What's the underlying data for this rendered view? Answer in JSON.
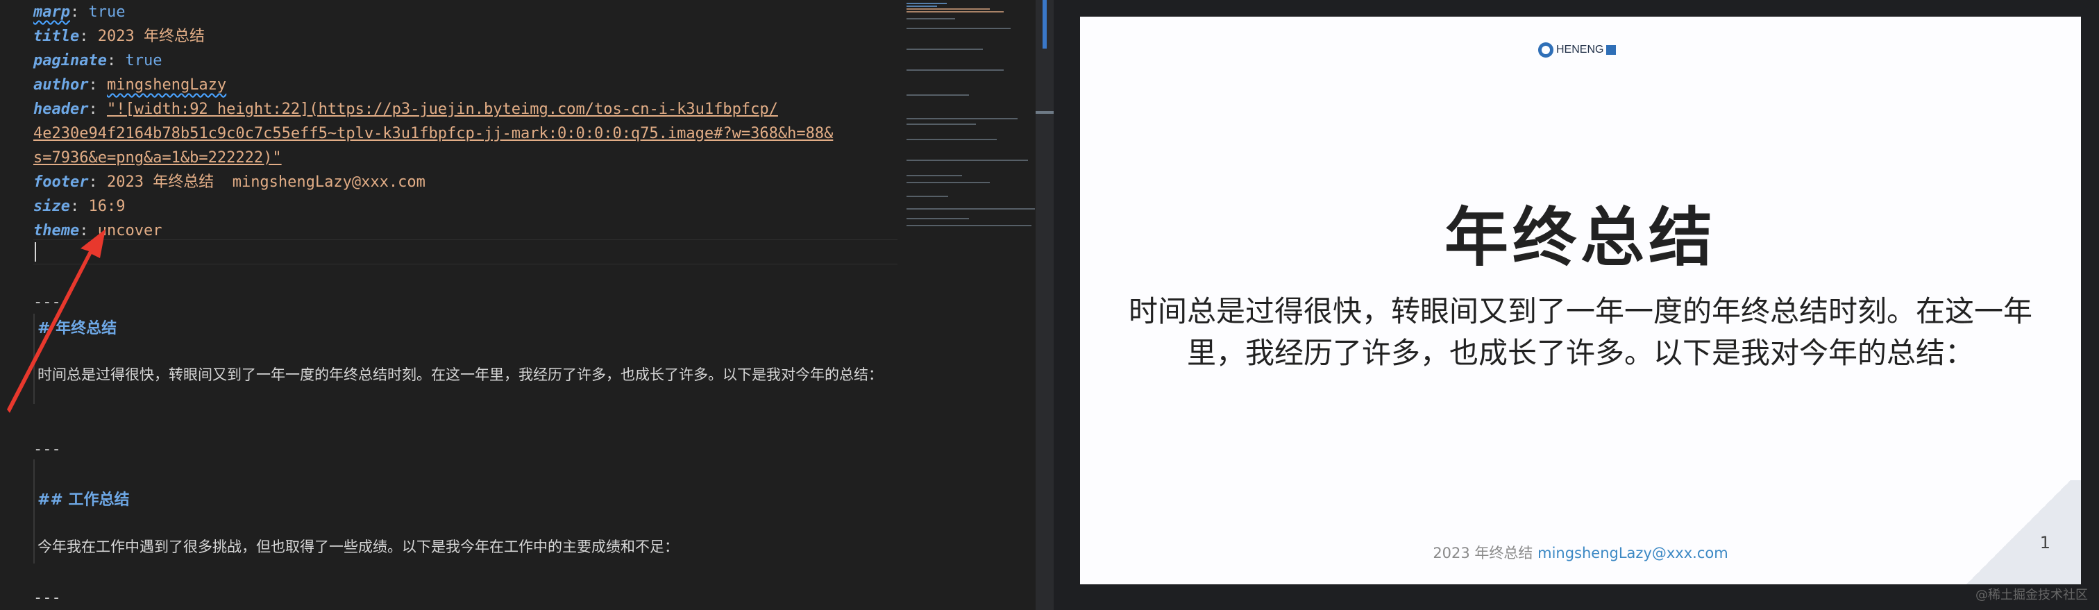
{
  "editor": {
    "frontmatter": {
      "marp_key": "marp",
      "marp_value": "true",
      "title_key": "title",
      "title_value": "2023 年终总结",
      "paginate_key": "paginate",
      "paginate_value": "true",
      "author_key": "author",
      "author_value": "mingshengLazy",
      "header_key": "header",
      "header_value_line1": "\"![width:92 height:22](https://p3-juejin.byteimg.com/tos-cn-i-k3u1fbpfcp/",
      "header_value_line2": "4e230e94f2164b78b51c9c0c7c55eff5~tplv-k3u1fbpfcp-jj-mark:0:0:0:0:q75.image#?w=368&h=88&",
      "header_value_line3": "s=7936&e=png&a=1&b=222222)\"",
      "footer_key": "footer",
      "footer_value": "2023 年终总结  mingshengLazy@xxx.com",
      "size_key": "size",
      "size_value": "16:9",
      "theme_key": "theme",
      "theme_value": "uncover"
    },
    "separator": "---",
    "sections": [
      {
        "heading": "# 年终总结",
        "text": "时间总是过得很快，转眼间又到了一年一度的年终总结时刻。在这一年里，我经历了许多，也成长了许多。以下是我对今年的总结："
      },
      {
        "heading": "## 工作总结",
        "text": "今年我在工作中遇到了很多挑战，但也取得了一些成绩。以下是我今年在工作中的主要成绩和不足："
      }
    ]
  },
  "preview": {
    "logo_text": "HENENG",
    "title": "年终总结",
    "body": "时间总是过得很快，转眼间又到了一年一度的年终总结时刻。在这一年里，我经历了许多，也成长了许多。以下是我对今年的总结：",
    "footer_text": "2023 年终总结 ",
    "footer_email": "mingshengLazy@xxx.com",
    "page_number": "1"
  },
  "watermark": "@稀土掘金技术社区",
  "colors": {
    "key": "#6ea8e6",
    "string": "#e2ad86",
    "arrow": "#e8382d"
  }
}
